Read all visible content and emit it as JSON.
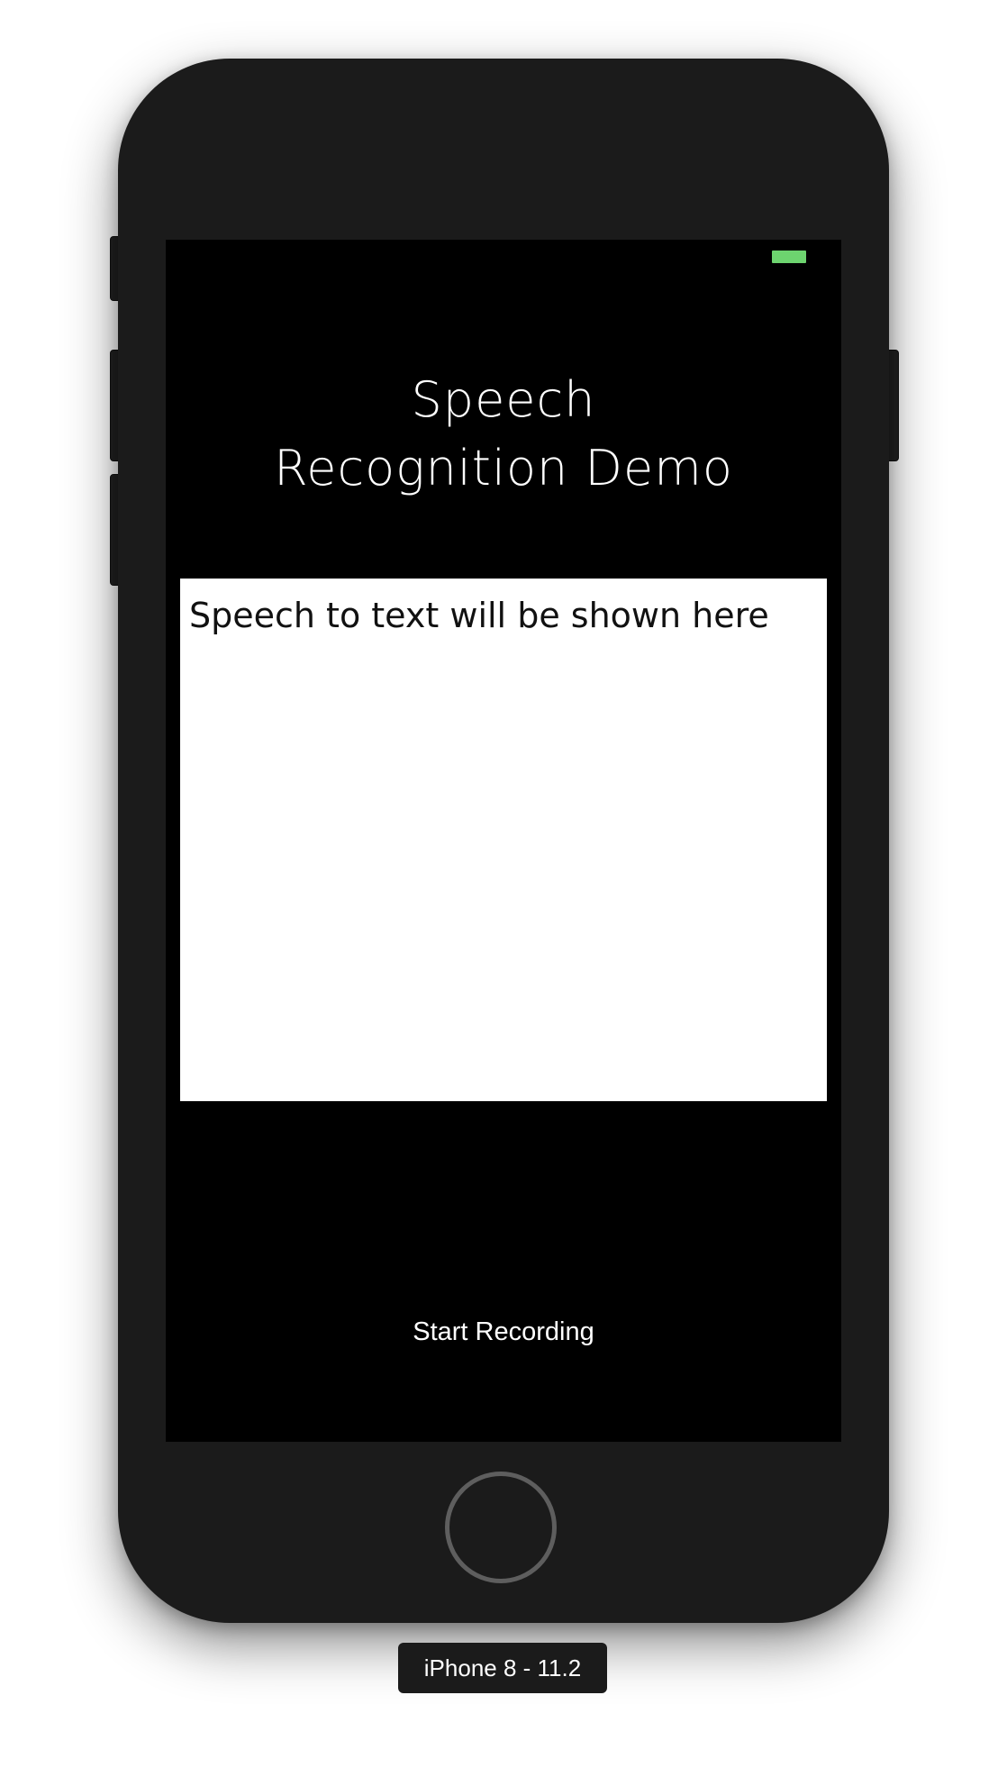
{
  "status_bar": {
    "battery_color": "#6dd46f"
  },
  "app": {
    "title_line1": "Speech",
    "title_line2": "Recognition Demo",
    "text_area_content": "Speech to text will be shown here",
    "record_button_label": "Start Recording"
  },
  "simulator": {
    "device_label": "iPhone 8 - 11.2"
  }
}
